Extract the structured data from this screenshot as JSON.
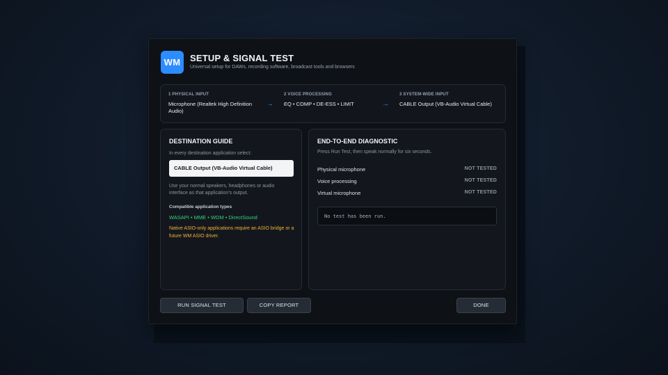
{
  "app": {
    "logo_text": "WM",
    "title": "SETUP & SIGNAL TEST",
    "subtitle": "Universal setup for DAWs, recording software, broadcast tools and browsers"
  },
  "pipeline": {
    "stages": [
      {
        "label": "1  PHYSICAL INPUT",
        "value": "Microphone (Realtek High Definition Audio)"
      },
      {
        "label": "2  VOICE PROCESSING",
        "value": "EQ • COMP • DE-ESS • LIMIT"
      },
      {
        "label": "3  SYSTEM-WIDE INPUT",
        "value": "CABLE Output (VB-Audio Virtual Cable)"
      }
    ],
    "arrow": "→"
  },
  "guide": {
    "title": "DESTINATION GUIDE",
    "instruction": "In every destination application select:",
    "device": "CABLE Output (VB-Audio Virtual Cable)",
    "description": "Use your normal speakers, headphones or audio interface as that application’s output.",
    "compat_title": "Compatible application types",
    "compat_types": "WASAPI • MME • WDM • DirectSound",
    "asio_note": "Native ASIO-only applications require an ASIO bridge or a future WM ASIO driver."
  },
  "diagnostic": {
    "title": "END-TO-END DIAGNOSTIC",
    "instruction": "Press Run Test, then speak normally for six seconds.",
    "rows": [
      {
        "label": "Physical microphone",
        "status": "NOT TESTED"
      },
      {
        "label": "Voice processing",
        "status": "NOT TESTED"
      },
      {
        "label": "Virtual microphone",
        "status": "NOT TESTED"
      }
    ],
    "log": "No test has been run."
  },
  "buttons": {
    "run": "RUN SIGNAL TEST",
    "copy": "COPY REPORT",
    "done": "DONE"
  },
  "colors": {
    "accent": "#2d8cff",
    "compat_green": "#34d27a",
    "warning_amber": "#f0b238"
  }
}
